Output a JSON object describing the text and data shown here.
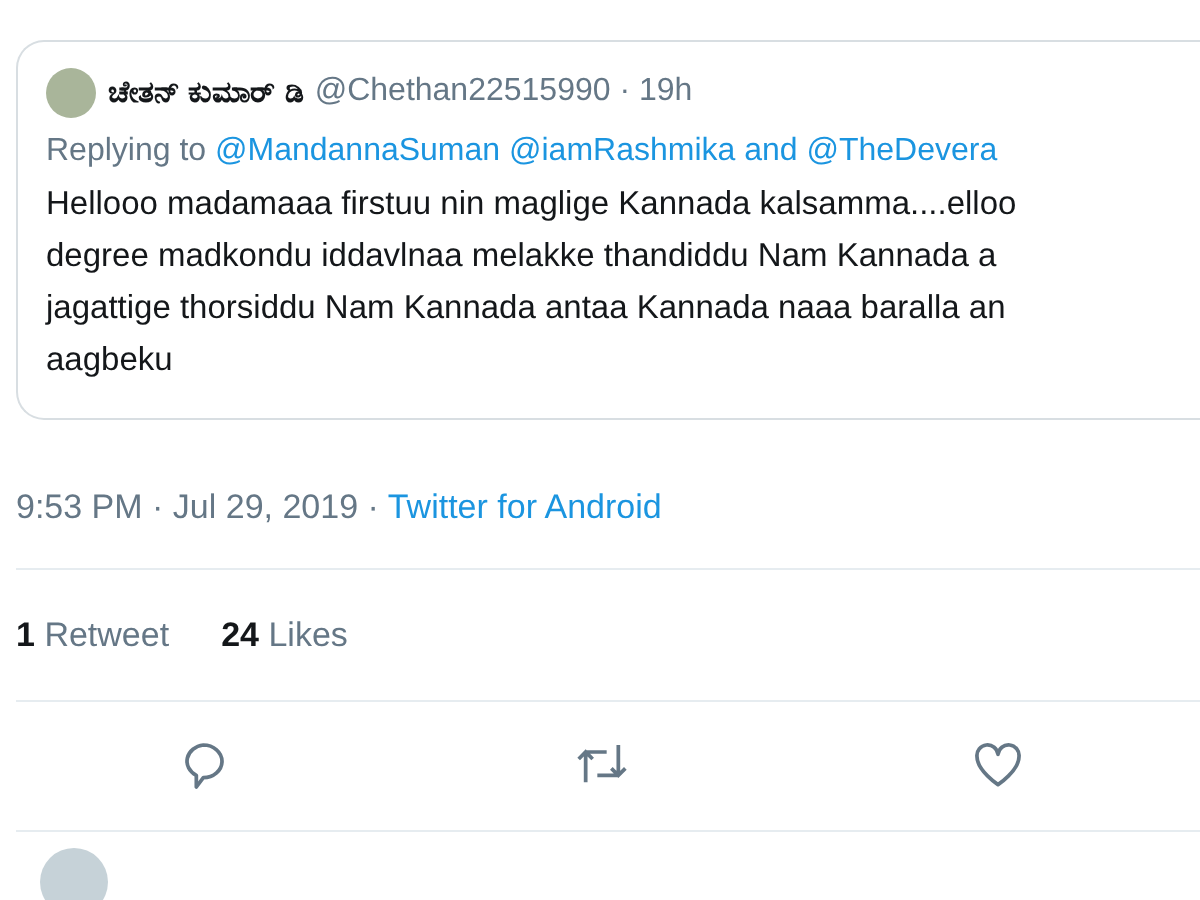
{
  "quoted_tweet": {
    "author_name": "ಚೇತನ್ ಕುಮಾರ್ ಡಿ",
    "handle_time": "@Chethan22515990 · 19h",
    "reply_prefix": "Replying to",
    "reply_handles": "@MandannaSuman @iamRashmika and @TheDevera",
    "text_lines": [
      "Hellooo madamaaa firstuu nin maglige Kannada kalsamma....elloo",
      "degree madkondu iddavlnaa melakke thandiddu Nam Kannada a",
      "jagattige thorsiddu Nam Kannada antaa Kannada naaa baralla an",
      "aagbeku"
    ]
  },
  "timestamp": "9:53 PM · Jul 29, 2019 ·",
  "source": "Twitter for Android",
  "stats": [
    {
      "count": "1",
      "label": "Retweet"
    },
    {
      "count": "24",
      "label": "Likes"
    }
  ],
  "actions": [
    {
      "kind": "reply"
    },
    {
      "kind": "retweet"
    },
    {
      "kind": "like"
    }
  ]
}
